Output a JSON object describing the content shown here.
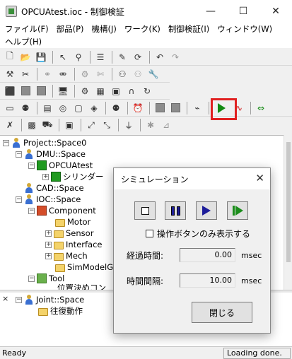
{
  "window": {
    "title": "OPCUAtest.ioc - 制御検証",
    "min_glyph": "—",
    "max_glyph": "☐",
    "close_glyph": "✕"
  },
  "menu": {
    "row1": [
      "ファイル(F)",
      "部品(P)",
      "機構(J)",
      "ワーク(K)",
      "制御検証(I)",
      "ウィンドウ(W)"
    ],
    "row2": [
      "ヘルプ(H)"
    ]
  },
  "tree": {
    "nodes": [
      {
        "label": "Project::Space0",
        "expander": "⊟"
      },
      {
        "label": "DMU::Space",
        "expander": "⊟"
      },
      {
        "label": "OPCUAtest",
        "expander": "⊟"
      },
      {
        "label": "シリンダー",
        "expander": "⊞"
      },
      {
        "label": "CAD::Space",
        "expander": ""
      },
      {
        "label": "IOC::Space",
        "expander": "⊟"
      },
      {
        "label": "Component",
        "expander": "⊟"
      },
      {
        "label": "Motor",
        "expander": ""
      },
      {
        "label": "Sensor",
        "expander": "⊞"
      },
      {
        "label": "Interface",
        "expander": "⊞"
      },
      {
        "label": "Mech",
        "expander": "⊞"
      },
      {
        "label": "SimModelGro",
        "expander": ""
      },
      {
        "label": "Tool",
        "expander": "⊟"
      },
      {
        "label": "位置決めコン",
        "expander": ""
      }
    ]
  },
  "lower_tree": {
    "close_glyph": "×",
    "nodes": [
      {
        "label": "Joint::Space",
        "expander": "⊟"
      },
      {
        "label": "往復動作",
        "expander": ""
      }
    ]
  },
  "status": {
    "left": "Ready",
    "right": "Loading done."
  },
  "dialog": {
    "title": "シミュレーション",
    "close_glyph": "✕",
    "checkbox_label": "操作ボタンのみ表示する",
    "checkbox_checked": false,
    "elapsed_label": "経過時間:",
    "elapsed_value": "0.00",
    "elapsed_unit": "msec",
    "interval_label": "時間間隔:",
    "interval_value": "10.00",
    "interval_unit": "msec",
    "close_button": "閉じる"
  },
  "colors": {
    "highlight_border": "#e02020",
    "play_green": "#128a12",
    "control_blue": "#1d1d9a"
  }
}
